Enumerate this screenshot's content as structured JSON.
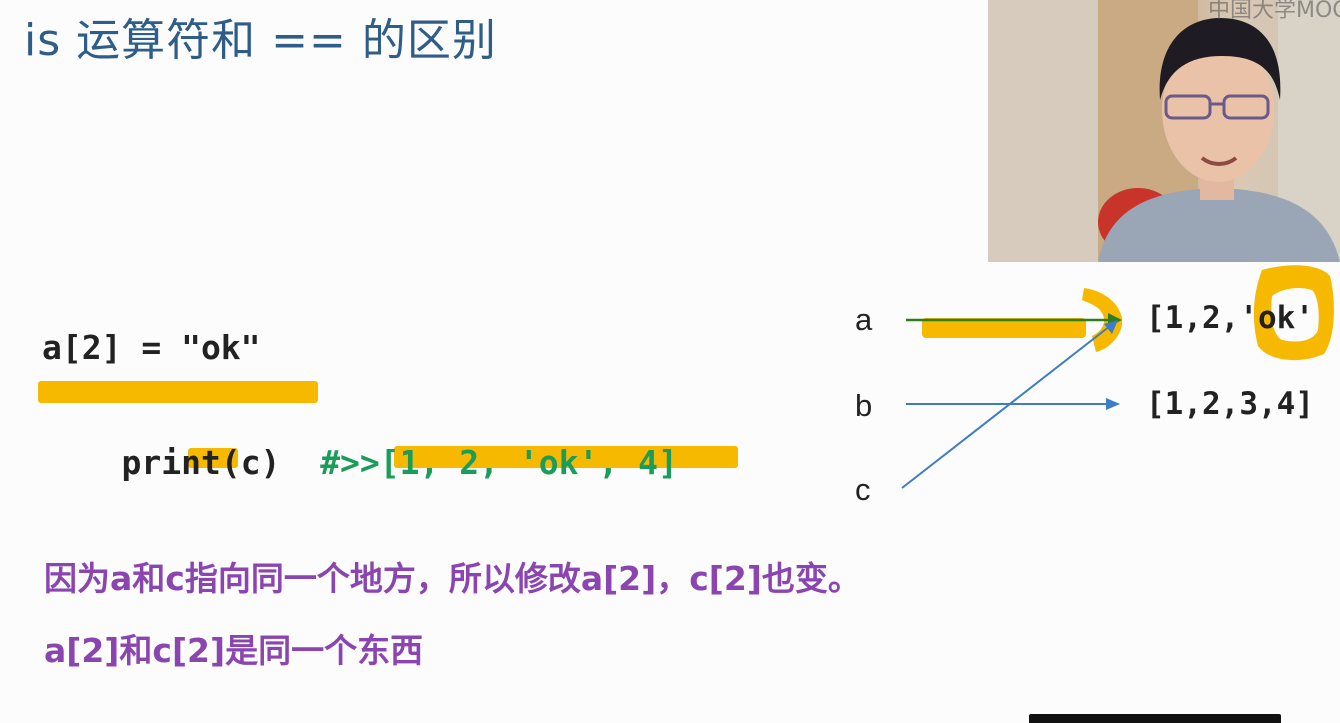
{
  "slide": {
    "title": "is 运算符和 == 的区别",
    "code_line1": "a[2] = \"ok\"",
    "code_line2_stmt": "print(c)",
    "code_line2_comment": "#>>[1, 2, 'ok', 4]",
    "diagram": {
      "var_a": "a",
      "var_b": "b",
      "var_c": "c",
      "list_top": "[1,2,'ok'",
      "list_bottom": "[1,2,3,4]"
    },
    "note_line1": "因为a和c指向同一个地方，所以修改a[2]，c[2]也变。",
    "note_line2": "a[2]和c[2]是同一个东西",
    "webcam_watermark": "中国大学MOOC"
  },
  "colors": {
    "title": "#2e5d8a",
    "highlight": "#f7b800",
    "comment": "#1a9c5a",
    "note": "#8a45b0",
    "arrow_blue": "#3e7cc4",
    "arrow_green": "#2f7d1f"
  }
}
